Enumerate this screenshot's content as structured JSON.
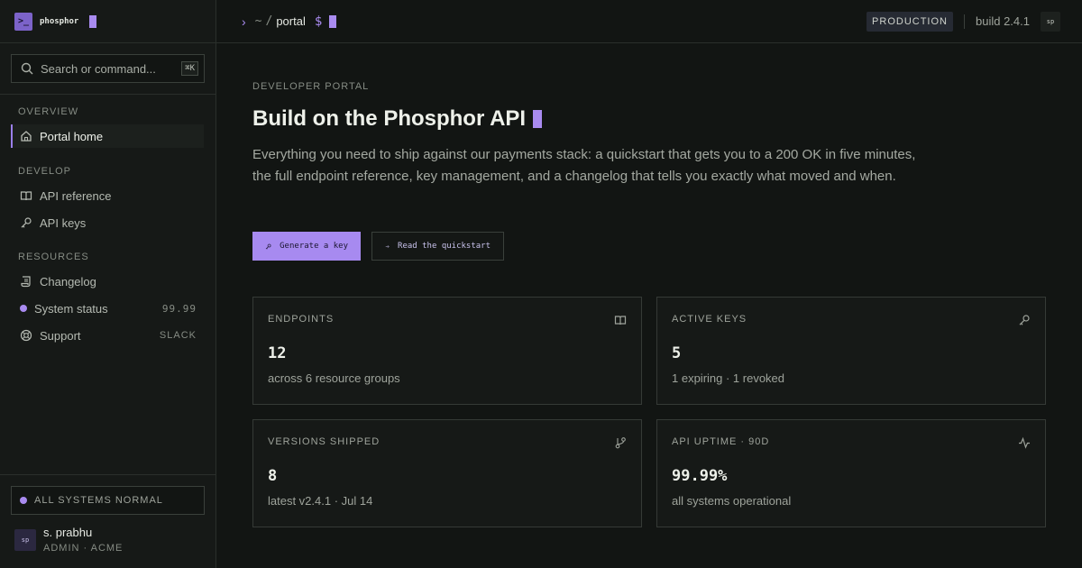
{
  "brand": {
    "logo_glyph": ">_",
    "name": "phosphor"
  },
  "search": {
    "placeholder": "Search or command...",
    "shortcut": "⌘K"
  },
  "nav": {
    "sections": [
      {
        "title": "OVERVIEW",
        "items": [
          {
            "label": "Portal home",
            "icon": "home-icon",
            "active": true
          }
        ]
      },
      {
        "title": "DEVELOP",
        "items": [
          {
            "label": "API reference",
            "icon": "book-icon"
          },
          {
            "label": "API keys",
            "icon": "key-icon"
          }
        ]
      },
      {
        "title": "RESOURCES",
        "items": [
          {
            "label": "Changelog",
            "icon": "scroll-icon"
          },
          {
            "label": "System status",
            "icon": "status-dot",
            "trail": "99.99"
          },
          {
            "label": "Support",
            "icon": "lifebuoy-icon",
            "trail": "SLACK"
          }
        ]
      }
    ]
  },
  "footer": {
    "status": "ALL SYSTEMS NORMAL",
    "user": {
      "initials": "sp",
      "name": "s. prabhu",
      "role": "ADMIN · ACME"
    }
  },
  "topbar": {
    "prompt": {
      "chevron": "›",
      "home": "~",
      "sep": "/",
      "dir": "portal",
      "symbol": "$"
    },
    "environment": "PRODUCTION",
    "build": "build 2.4.1",
    "user_initials": "sp"
  },
  "hero": {
    "eyebrow": "DEVELOPER PORTAL",
    "title": "Build on the Phosphor API",
    "lede": "Everything you need to ship against our payments stack: a quickstart that gets you to a 200 OK in five minutes, the full endpoint reference, key management, and a changelog that tells you exactly what moved and when.",
    "primary_cta": "Generate a key",
    "secondary_cta": "Read the quickstart"
  },
  "stats": [
    {
      "label": "ENDPOINTS",
      "value": "12",
      "sub": "across 6 resource groups",
      "icon": "book-icon"
    },
    {
      "label": "ACTIVE KEYS",
      "value": "5",
      "sub": "1 expiring · 1 revoked",
      "icon": "key-icon"
    },
    {
      "label": "VERSIONS SHIPPED",
      "value": "8",
      "sub": "latest v2.4.1 · Jul 14",
      "icon": "branch-icon"
    },
    {
      "label": "API UPTIME · 90D",
      "value": "99.99%",
      "sub": "all systems operational",
      "icon": "pulse-icon"
    }
  ],
  "colors": {
    "accent": "#a98bf0",
    "background": "#121513",
    "panel": "#161917"
  }
}
